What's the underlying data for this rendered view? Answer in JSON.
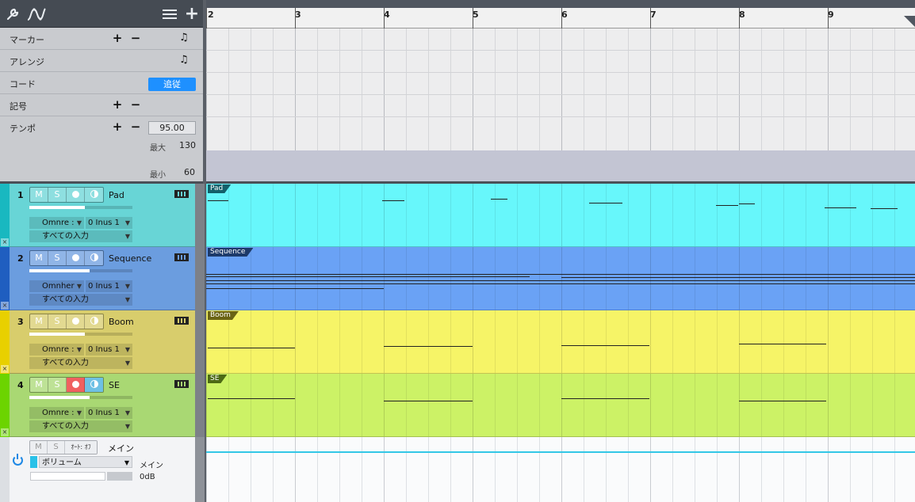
{
  "toolbar": {
    "icons": [
      "wrench-icon",
      "automation-curve-icon",
      "list-icon",
      "add-icon"
    ]
  },
  "global_tracks": {
    "marker": {
      "label": "マーカー"
    },
    "arrange": {
      "label": "アレンジ"
    },
    "chord": {
      "label": "コード",
      "follow_label": "追従"
    },
    "signature": {
      "label": "記号"
    },
    "tempo": {
      "label": "テンポ",
      "value": "95.00",
      "max_label": "最大",
      "max_value": "130",
      "min_label": "最小",
      "min_value": "60"
    }
  },
  "ruler": {
    "bars": [
      "2",
      "3",
      "4",
      "5",
      "6",
      "7",
      "8",
      "9"
    ]
  },
  "tracks": [
    {
      "number": "1",
      "name": "Pad",
      "mute": "M",
      "solo": "S",
      "input_device": "Omnre :",
      "input_channel": "0 Inus 1",
      "input_all": "すべての入力",
      "color": "#68d5d6",
      "lane_color": "#67f7fb",
      "tag_color": "#13606a",
      "clip_name": "Pad",
      "rec_active": false,
      "monitor_active": false
    },
    {
      "number": "2",
      "name": "Sequence",
      "mute": "M",
      "solo": "S",
      "input_device": "Omnher",
      "input_channel": "0 Inus 1",
      "input_all": "すべての入力",
      "color": "#6b9ddf",
      "lane_color": "#6aa2f5",
      "tag_color": "#1d3a6a",
      "clip_name": "Sequence",
      "rec_active": false,
      "monitor_active": false
    },
    {
      "number": "3",
      "name": "Boom",
      "mute": "M",
      "solo": "S",
      "input_device": "Omnre :",
      "input_channel": "0 Inus 1",
      "input_all": "すべての入力",
      "color": "#d8cd6c",
      "lane_color": "#f6f467",
      "tag_color": "#6b6415",
      "clip_name": "Boom",
      "rec_active": false,
      "monitor_active": false
    },
    {
      "number": "4",
      "name": "SE",
      "mute": "M",
      "solo": "S",
      "input_device": "Omnre :",
      "input_channel": "0 Inus 1",
      "input_all": "すべての入力",
      "color": "#a9d873",
      "lane_color": "#ccf266",
      "tag_color": "#4d6a15",
      "clip_name": "SE",
      "rec_active": true,
      "monitor_active": true
    }
  ],
  "main": {
    "mute": "M",
    "solo": "S",
    "auto": "ｵｰﾄ: ｵﾌ",
    "name": "メイン",
    "param": "ボリューム",
    "output": "メイン",
    "level": "0dB"
  }
}
